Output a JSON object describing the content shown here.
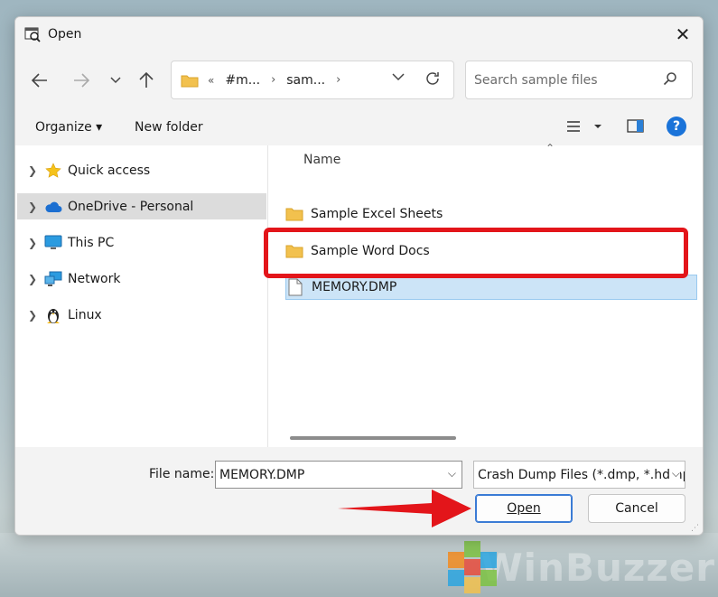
{
  "window": {
    "title": "Open",
    "close_icon": "✕"
  },
  "address": {
    "crumbs": [
      "«",
      "#m...",
      "sam..."
    ],
    "separator": "›"
  },
  "search": {
    "placeholder": "Search sample files"
  },
  "toolbar": {
    "organize_label": "Organize ▾",
    "new_folder_label": "New folder",
    "help_label": "?"
  },
  "sidebar": {
    "items": [
      {
        "label": "Quick access",
        "icon": "star-icon"
      },
      {
        "label": "OneDrive - Personal",
        "icon": "cloud-icon",
        "selected": true
      },
      {
        "label": "This PC",
        "icon": "monitor-icon"
      },
      {
        "label": "Network",
        "icon": "network-icon"
      },
      {
        "label": "Linux",
        "icon": "linux-penguin-icon"
      }
    ]
  },
  "filelist": {
    "column_header": "Name",
    "files": [
      {
        "name": "Sample Excel Sheets",
        "type": "folder"
      },
      {
        "name": "Sample Word Docs",
        "type": "folder"
      },
      {
        "name": "MEMORY.DMP",
        "type": "file",
        "selected": true
      }
    ]
  },
  "bottom": {
    "file_name_label": "File name:",
    "file_name_value": "MEMORY.DMP",
    "filter_value": "Crash Dump Files (*.dmp, *.hdmp)",
    "open_label": "Open",
    "cancel_label": "Cancel"
  },
  "watermark": {
    "text": "WinBuzzer"
  },
  "colors": {
    "accent": "#1a73d9",
    "highlight_red": "#e3151a",
    "selection_blue": "#cce4f7",
    "folder_yellow": "#f2c14e"
  }
}
